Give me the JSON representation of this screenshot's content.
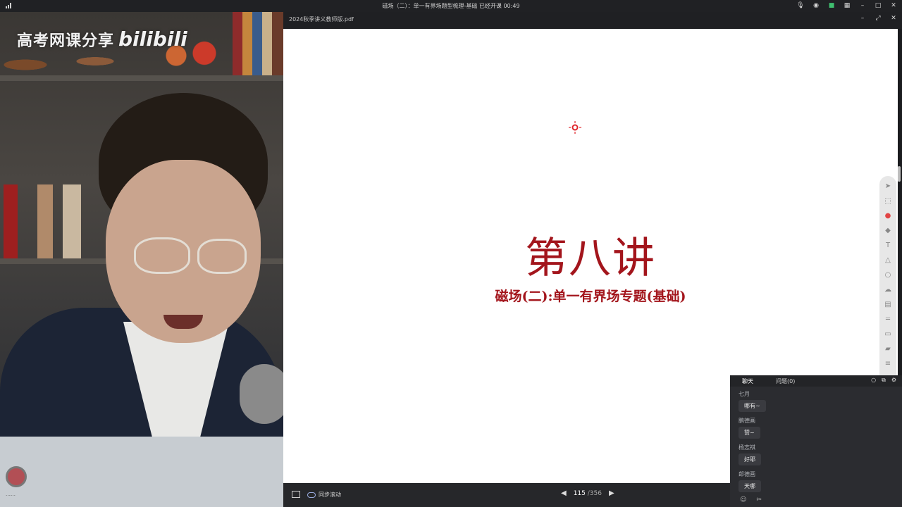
{
  "window": {
    "title": "磁场（二）：单一有界场题型梳理-基础   已经开课 00:49"
  },
  "watermark": {
    "channel": "高考网课分享",
    "logo": "bilibili"
  },
  "camera": {
    "avatar_label": "……"
  },
  "document": {
    "file_name": "2024秋季讲义教师版.pdf",
    "lecture_title": "第八讲",
    "lecture_subtitle": "磁场(二):单一有界场专题(基础)"
  },
  "footer": {
    "sync_label": "同步滚动",
    "current_page": "115",
    "total_pages": "/356"
  },
  "chat": {
    "tabs": [
      "聊天",
      "问题(0)"
    ],
    "messages": [
      {
        "name": "七月",
        "text": "哪有~"
      },
      {
        "name": "鹏德画",
        "text": "赞~"
      },
      {
        "name": "杨志祺",
        "text": "好耶"
      },
      {
        "name": "郎德画",
        "text": "天哪"
      }
    ]
  },
  "icons": {
    "signal": "signal-icon",
    "mic": "microphone-icon",
    "record": "record-icon",
    "minimize": "minimize-icon",
    "maximize": "maximize-icon",
    "close": "close-icon"
  },
  "colors": {
    "title_red": "#a3151c",
    "bar_dark": "#202124",
    "chat_bg": "#2b2c30"
  }
}
